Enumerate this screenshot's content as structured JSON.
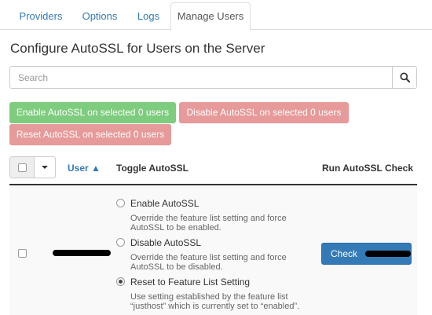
{
  "tabs": [
    {
      "label": "Providers"
    },
    {
      "label": "Options"
    },
    {
      "label": "Logs"
    },
    {
      "label": "Manage Users"
    }
  ],
  "page_title": "Configure AutoSSL for Users on the Server",
  "search": {
    "placeholder": "Search",
    "icon": "search-icon"
  },
  "bulk_buttons": {
    "enable": "Enable AutoSSL on selected 0 users",
    "disable": "Disable AutoSSL on selected 0 users",
    "reset": "Reset AutoSSL on selected 0 users"
  },
  "table": {
    "headers": {
      "user": "User ▲",
      "toggle": "Toggle AutoSSL",
      "run": "Run AutoSSL Check"
    },
    "row": {
      "options": [
        {
          "label": "Enable AutoSSL",
          "desc": "Override the feature list setting and force AutoSSL to be enabled.",
          "checked": false
        },
        {
          "label": "Disable AutoSSL",
          "desc": "Override the feature list setting and force AutoSSL to be disabled.",
          "checked": false
        },
        {
          "label": "Reset to Feature List Setting",
          "desc": "Use setting established by the feature list “justhost” which is currently set to “enabled”.",
          "checked": true
        }
      ],
      "check_label": "Check"
    }
  },
  "colors": {
    "link": "#337ab7",
    "enable_button": "#7ecc7e",
    "danger_button": "#e69a99",
    "primary_button": "#337ab7"
  }
}
